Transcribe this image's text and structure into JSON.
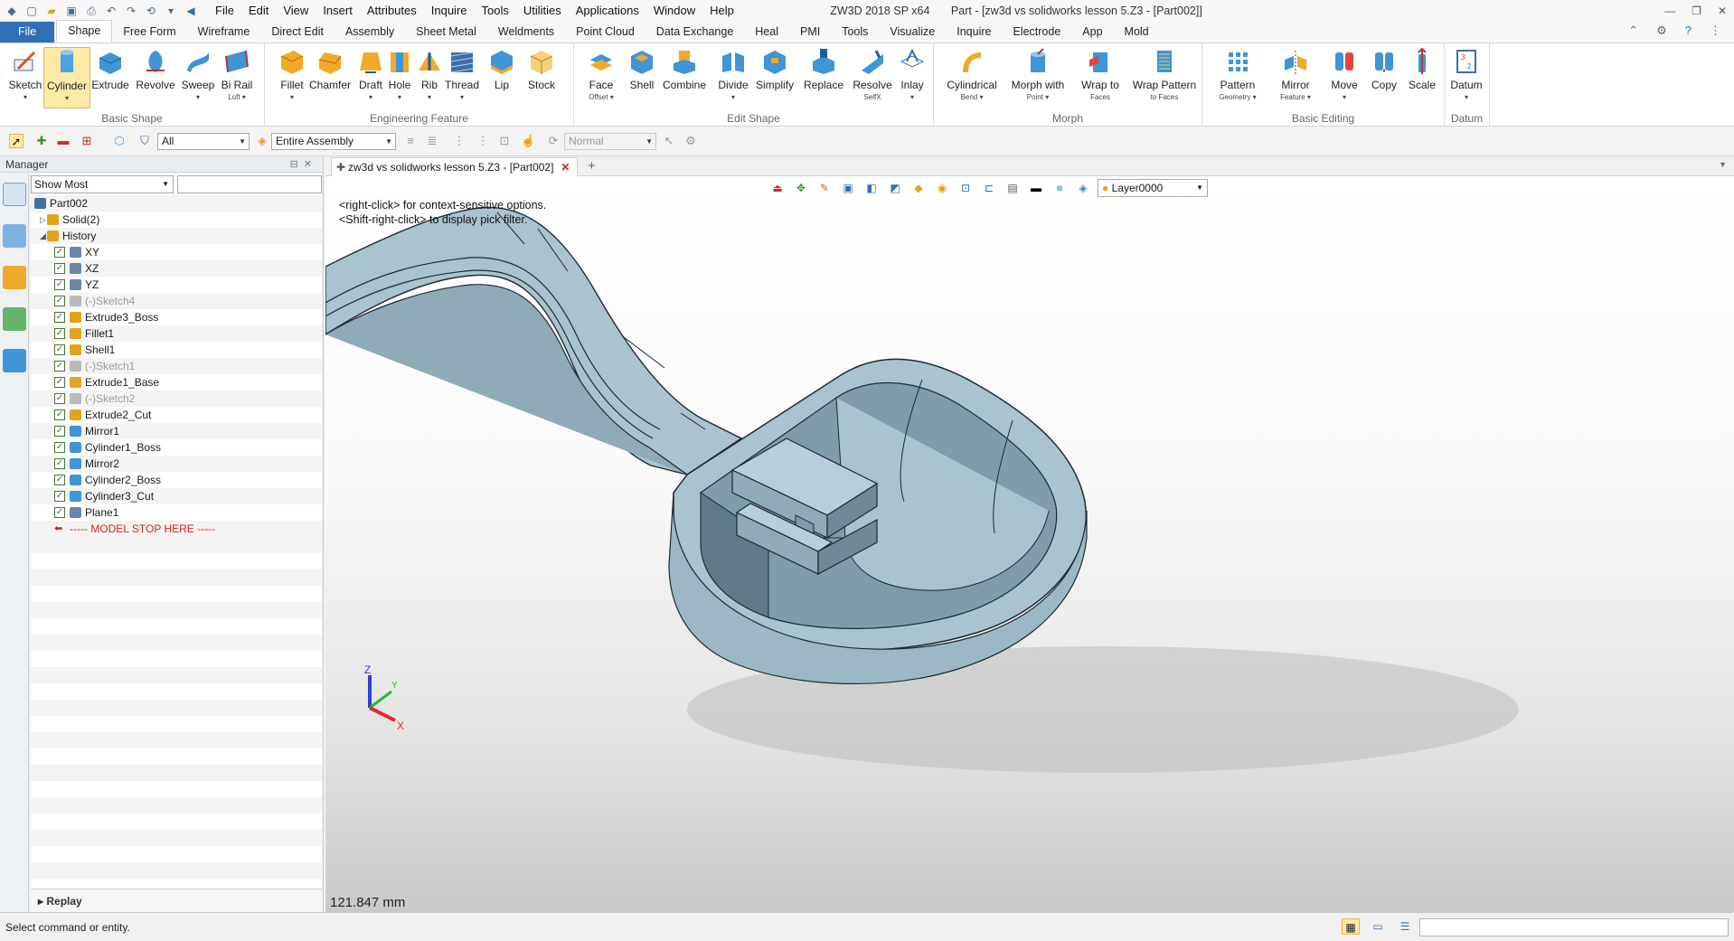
{
  "window": {
    "app_name": "ZW3D 2018 SP x64",
    "doc_title": "Part - [zw3d vs solidworks lesson 5.Z3 - [Part002]]"
  },
  "menu": [
    "File",
    "Edit",
    "View",
    "Insert",
    "Attributes",
    "Inquire",
    "Tools",
    "Utilities",
    "Applications",
    "Window",
    "Help"
  ],
  "ribbon_tabs": [
    "File",
    "Shape",
    "Free Form",
    "Wireframe",
    "Direct Edit",
    "Assembly",
    "Sheet Metal",
    "Weldments",
    "Point Cloud",
    "Data Exchange",
    "Heal",
    "PMI",
    "Tools",
    "Visualize",
    "Inquire",
    "Electrode",
    "App",
    "Mold"
  ],
  "active_tab": "Shape",
  "ribbon": {
    "basic_shape": {
      "label": "Basic Shape",
      "buttons": [
        {
          "l1": "Sketch",
          "l2": "▾"
        },
        {
          "l1": "Cylinder",
          "l2": "▾"
        },
        {
          "l1": "Extrude",
          "l2": ""
        },
        {
          "l1": "Revolve",
          "l2": ""
        },
        {
          "l1": "Sweep",
          "l2": "▾"
        },
        {
          "l1": "Bi Rail",
          "l2": "Loft ▾"
        }
      ]
    },
    "engineering_feature": {
      "label": "Engineering Feature",
      "buttons": [
        {
          "l1": "Fillet",
          "l2": "▾"
        },
        {
          "l1": "Chamfer",
          "l2": ""
        },
        {
          "l1": "Draft",
          "l2": "▾"
        },
        {
          "l1": "Hole",
          "l2": "▾"
        },
        {
          "l1": "Rib",
          "l2": "▾"
        },
        {
          "l1": "Thread",
          "l2": "▾"
        },
        {
          "l1": "Lip",
          "l2": ""
        },
        {
          "l1": "Stock",
          "l2": ""
        }
      ]
    },
    "edit_shape": {
      "label": "Edit Shape",
      "buttons": [
        {
          "l1": "Face",
          "l2": "Offset ▾"
        },
        {
          "l1": "Shell",
          "l2": ""
        },
        {
          "l1": "Combine",
          "l2": ""
        },
        {
          "l1": "Divide",
          "l2": "▾"
        },
        {
          "l1": "Simplify",
          "l2": ""
        },
        {
          "l1": "Replace",
          "l2": ""
        },
        {
          "l1": "Resolve",
          "l2": "SelfX"
        },
        {
          "l1": "Inlay",
          "l2": "▾"
        }
      ]
    },
    "morph": {
      "label": "Morph",
      "buttons": [
        {
          "l1": "Cylindrical",
          "l2": "Bend ▾"
        },
        {
          "l1": "Morph with",
          "l2": "Point ▾"
        },
        {
          "l1": "Wrap to",
          "l2": "Faces"
        },
        {
          "l1": "Wrap Pattern",
          "l2": "to Faces"
        }
      ]
    },
    "basic_editing": {
      "label": "Basic Editing",
      "buttons": [
        {
          "l1": "Pattern",
          "l2": "Geometry ▾"
        },
        {
          "l1": "Mirror",
          "l2": "Feature ▾"
        },
        {
          "l1": "Move",
          "l2": "▾"
        },
        {
          "l1": "Copy",
          "l2": ""
        },
        {
          "l1": "Scale",
          "l2": ""
        }
      ]
    },
    "datum": {
      "label": "Datum",
      "buttons": [
        {
          "l1": "Datum",
          "l2": "▾"
        }
      ]
    }
  },
  "toolbar2": {
    "filter_value": "All",
    "assembly_value": "Entire Assembly",
    "mode_value": "Normal"
  },
  "manager": {
    "title": "Manager",
    "filter_value": "Show Most",
    "tree": [
      {
        "label": "Part002",
        "level": 0,
        "type": "part",
        "exp": ""
      },
      {
        "label": "Solid(2)",
        "level": 1,
        "type": "folder",
        "exp": "▷"
      },
      {
        "label": "History",
        "level": 1,
        "type": "folder",
        "exp": "◢"
      },
      {
        "label": "XY",
        "level": 2,
        "type": "plane",
        "check": true
      },
      {
        "label": "XZ",
        "level": 2,
        "type": "plane",
        "check": true
      },
      {
        "label": "YZ",
        "level": 2,
        "type": "plane",
        "check": true
      },
      {
        "label": "(-)Sketch4",
        "level": 2,
        "type": "sketch",
        "check": true,
        "dim": true
      },
      {
        "label": "Extrude3_Boss",
        "level": 2,
        "type": "feature",
        "check": true
      },
      {
        "label": "Fillet1",
        "level": 2,
        "type": "feature",
        "check": true
      },
      {
        "label": "Shell1",
        "level": 2,
        "type": "feature",
        "check": true
      },
      {
        "label": "(-)Sketch1",
        "level": 2,
        "type": "sketch",
        "check": true,
        "dim": true
      },
      {
        "label": "Extrude1_Base",
        "level": 2,
        "type": "feature",
        "check": true
      },
      {
        "label": "(-)Sketch2",
        "level": 2,
        "type": "sketch",
        "check": true,
        "dim": true
      },
      {
        "label": "Extrude2_Cut",
        "level": 2,
        "type": "feature",
        "check": true
      },
      {
        "label": "Mirror1",
        "level": 2,
        "type": "mirror",
        "check": true
      },
      {
        "label": "Cylinder1_Boss",
        "level": 2,
        "type": "cylinder",
        "check": true
      },
      {
        "label": "Mirror2",
        "level": 2,
        "type": "mirror",
        "check": true
      },
      {
        "label": "Cylinder2_Boss",
        "level": 2,
        "type": "cylinder",
        "check": true
      },
      {
        "label": "Cylinder3_Cut",
        "level": 2,
        "type": "cylinder",
        "check": true
      },
      {
        "label": "Plane1",
        "level": 2,
        "type": "plane",
        "check": true
      },
      {
        "label": "----- MODEL STOP HERE -----",
        "level": 2,
        "type": "stop"
      }
    ],
    "replay_label": "Replay"
  },
  "doc_tab": {
    "title": "zw3d vs solidworks lesson 5.Z3 - [Part002]"
  },
  "viewport": {
    "hint1": "<right-click> for context-sensitive options.",
    "hint2": "<Shift-right-click> to display pick filter.",
    "layer": "Layer0000",
    "scale": "121.847 mm",
    "axes": [
      "Z",
      "Y",
      "X"
    ]
  },
  "status": {
    "text": "Select command or entity."
  },
  "colors": {
    "model": "#a9c3cf",
    "model_dark": "#6f8a97",
    "file_tab": "#2f6fb8",
    "selected_button": "#fde9a8"
  }
}
